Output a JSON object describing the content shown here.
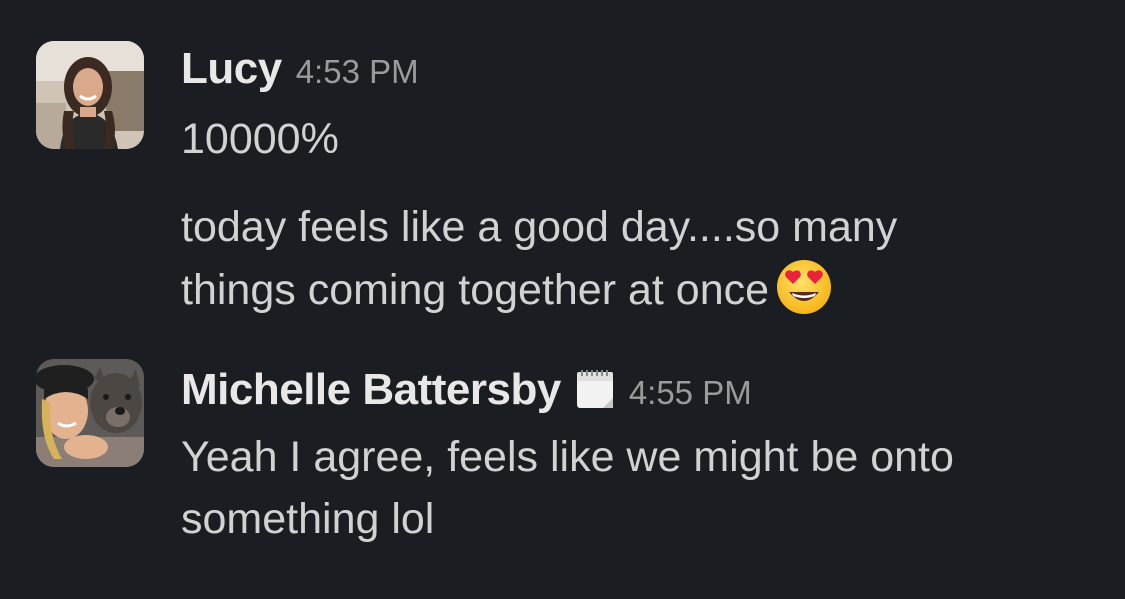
{
  "messages": [
    {
      "author": "Lucy",
      "time": "4:53 PM",
      "avatar_icon": "avatar-photo-woman-smiling",
      "lines": [
        "10000%"
      ]
    },
    {
      "continuation": true,
      "lines": [
        "today feels like a good day....so many",
        "things coming together at once"
      ],
      "trailing_emoji": "heart-eyes-emoji"
    },
    {
      "author": "Michelle Battersby",
      "time": "4:55 PM",
      "status_emoji": "calendar-icon",
      "avatar_icon": "avatar-photo-woman-with-dog",
      "lines": [
        "Yeah I agree, feels like we might be onto",
        "something lol"
      ]
    }
  ],
  "colors": {
    "background": "#1a1d21",
    "text": "#d1d2d3",
    "name": "#e8e8e8",
    "timestamp": "#9a9b9d"
  }
}
